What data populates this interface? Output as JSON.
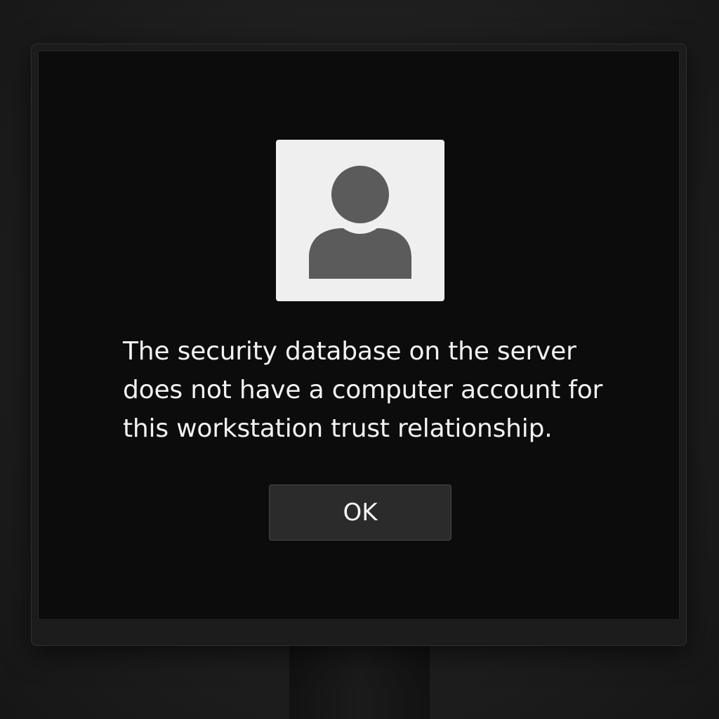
{
  "dialog": {
    "icon": "user-avatar-icon",
    "message": "The security database on the server does not have a computer account for this workstation trust relationship.",
    "ok_label": "OK"
  },
  "colors": {
    "screen_background": "#0c0c0c",
    "avatar_tile": "#efefef",
    "avatar_silhouette": "#5b5b5b",
    "button_background": "#2b2b2b",
    "text": "#f2f2f2"
  }
}
